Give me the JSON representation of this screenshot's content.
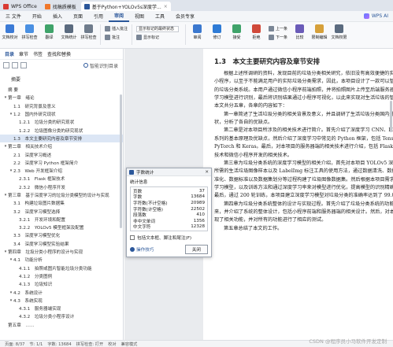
{
  "titlebar": {
    "tabs": [
      {
        "label": "WPS Office",
        "color": "#d93a33"
      },
      {
        "label": "找稿质模板",
        "color": "#f0782b"
      },
      {
        "label": "基于Python+YOLOv5s深度学...",
        "color": "#2b579a"
      }
    ]
  },
  "menu": {
    "items": [
      "三 文件",
      "开始",
      "插入",
      "页面",
      "引用",
      "审阅",
      "视图",
      "工具",
      "会员专享"
    ],
    "active": "审阅",
    "ai": "WPS AI"
  },
  "ribbon": {
    "buttons": [
      {
        "label": "文档校对",
        "color": "#3c7bd6"
      },
      {
        "label": "拼写检查",
        "color": "#4a90e2"
      },
      {
        "label": "翻译",
        "color": "#3fa36a"
      },
      {
        "label": "文档统计",
        "color": "#5b6b7f"
      },
      {
        "label": "拼写检查",
        "color": "#6f7c8c"
      }
    ],
    "insert_label": "插入批注",
    "comment_label": "批注",
    "markup": "显示标记的最终状态",
    "show_markup": "显示标记",
    "review": "审阅",
    "track": "修订",
    "accept": "接受",
    "reject": "拒绝",
    "prev": "上一条",
    "next": "下一条",
    "compare": "比较",
    "protect": "限制编辑",
    "doc_rights": "文档权限",
    "icon_colors": {
      "review": "#3b78cf",
      "track": "#2e7bd6",
      "accept": "#3fa36a",
      "reject": "#d0493a",
      "compare": "#6a5bb8",
      "protect": "#d6a03a",
      "doc_rights": "#5b6b7f"
    }
  },
  "sidebar": {
    "tabs": [
      "目录",
      "章节",
      "书签",
      "查找和替换"
    ],
    "active_tab": "目录",
    "smart": "智能识别目录",
    "heading": "摘要",
    "items": [
      {
        "level": 0,
        "arrow": "",
        "text": "摘 要"
      },
      {
        "level": 0,
        "arrow": "▾",
        "text": "第一章　绪论"
      },
      {
        "level": 1,
        "arrow": "",
        "text": "1.1　研究背景及意义"
      },
      {
        "level": 1,
        "arrow": "▾",
        "text": "1.2　国内外研究现状"
      },
      {
        "level": 2,
        "arrow": "",
        "text": "1.2.1　垃圾分类的研究现状"
      },
      {
        "level": 2,
        "arrow": "",
        "text": "1.2.2　垃圾图像分类的研究现状"
      },
      {
        "level": 1,
        "arrow": "",
        "text": "1.3　本文主要研究内容及章节安排",
        "highlight": true
      },
      {
        "level": 0,
        "arrow": "▾",
        "text": "第二章　相关技术介绍"
      },
      {
        "level": 1,
        "arrow": "",
        "text": "2.1　深度学习概述"
      },
      {
        "level": 1,
        "arrow": "",
        "text": "2.2　深度学习 Python 框架简介"
      },
      {
        "level": 1,
        "arrow": "▾",
        "text": "2.3　Web 开发框架介绍"
      },
      {
        "level": 2,
        "arrow": "",
        "text": "2.3.1　Flask 框架技术"
      },
      {
        "level": 2,
        "arrow": "",
        "text": "2.3.2　微信小程序开发"
      },
      {
        "level": 0,
        "arrow": "▾",
        "text": "第三章　基于深度学习的垃圾分类模型的设计与实现"
      },
      {
        "level": 1,
        "arrow": "",
        "text": "3.1　构建垃圾图片数据集"
      },
      {
        "level": 1,
        "arrow": "",
        "text": "3.2　深度学习模型选择"
      },
      {
        "level": 2,
        "arrow": "",
        "text": "3.2.1　开发环境和配置"
      },
      {
        "level": 2,
        "arrow": "",
        "text": "3.2.2　YOLOv5 模型框架及配置"
      },
      {
        "level": 1,
        "arrow": "",
        "text": "3.3　深度学习模型优化"
      },
      {
        "level": 1,
        "arrow": "",
        "text": "3.4　深度学习模型实验结果"
      },
      {
        "level": 0,
        "arrow": "▾",
        "text": "第四章　垃圾分类小程序的设计与实现"
      },
      {
        "level": 1,
        "arrow": "▾",
        "text": "4.1　功能分析"
      },
      {
        "level": 2,
        "arrow": "",
        "text": "4.1.1　拍照或图片智能垃圾分类功能"
      },
      {
        "level": 2,
        "arrow": "",
        "text": "4.1.2　分类图例"
      },
      {
        "level": 2,
        "arrow": "",
        "text": "4.1.3　垃圾知识"
      },
      {
        "level": 1,
        "arrow": "▾",
        "text": "4.2　系统设计"
      },
      {
        "level": 1,
        "arrow": "▾",
        "text": "4.3　系统实现"
      },
      {
        "level": 2,
        "arrow": "",
        "text": "4.3.1　服务器端实现"
      },
      {
        "level": 2,
        "arrow": "",
        "text": "4.3.2　垃圾分类小程序设计"
      },
      {
        "level": 0,
        "arrow": "",
        "text": "第五章　……"
      }
    ]
  },
  "document": {
    "heading": "1.3　本文主要研究内容及章节安排",
    "lines": [
      {
        "indent": true,
        "text": "根据上述所调研的资料，发现目前的垃圾分类相关研究，依旧没有高效便捷的实现垃圾分类"
      },
      {
        "indent": false,
        "text": "小程序，以至于不能满足用户的实际垃圾分类需求，因此，本项目设计了一款可以智能识别垃圾"
      },
      {
        "indent": false,
        "text": "的垃圾分类系统。本用户通过微信小程序前端拍照，并将拍照图片上传至后端服务器，调用深度"
      },
      {
        "indent": false,
        "text": "学习模型进行识别，最后将识别结果通过小程序可视化，以此来实现对生活垃圾的智能分类。"
      },
      {
        "indent": false,
        "text": "本文共分五章，各章的内容如下："
      },
      {
        "indent": true,
        "text": "第一章简述了生活垃圾分类的相关背景及意义，并且调研了生活垃圾分类国内外的研究现"
      },
      {
        "indent": false,
        "text": "状，分析了各自的优缺点。"
      },
      {
        "indent": true,
        "text": "第二章是对本项目所涉及的相关技术进行简介。首先介绍了深度学习 CNN、RNN、GAN"
      },
      {
        "indent": false,
        "text": "系列的基本原理及优缺点，然后介绍了深度学习中常见的 Python 框架，包括 TensorFlow、"
      },
      {
        "indent": false,
        "text": "PyTorch 和 Keras。最后，对本项目的服务器端的相关技术进行介绍，包括 Flask 框架"
      },
      {
        "indent": false,
        "text": "技术和微信小程序开发的相关技术。"
      },
      {
        "indent": true,
        "text": "第三章为垃圾分类系统的深度学习模型的相关介绍，首先对本项目 YOLOv5 深度学习模型"
      },
      {
        "indent": false,
        "text": "所需的生活垃圾图像样本以及 LabelImg 标注工具的使用方法，通过数据清洗、数据标"
      },
      {
        "indent": false,
        "text": "准化、数据标准以及数据集划分等过程构建了垃圾图像数据集。然后根据本项目需求选择深度"
      },
      {
        "indent": false,
        "text": "学习模型，以及训练方法和通过深度学习率来对模型进行优化，提高模型的识别精确率。"
      },
      {
        "indent": false,
        "text": "最后，通过 200 轮训练，本项目建立深度学习模型对垃圾分类的准确率达到了 99.0%。"
      },
      {
        "indent": true,
        "text": "第四章为垃圾分类系统整体的设计与实现过程。首先介绍了垃圾分类系统的功能需求分析，"
      },
      {
        "indent": false,
        "text": "来，并介绍了系统的整体设计，包括小程序前端和服务器端的相关设计。然后，对本系统进行"
      },
      {
        "indent": false,
        "text": "现了相关功能，并对所有的功能进行了相应的测试。"
      },
      {
        "indent": true,
        "text": "第五章总结了本文的工作。"
      }
    ]
  },
  "dialog": {
    "title": "字数统计",
    "stats_label": "统计信息",
    "rows": [
      {
        "k": "页数",
        "v": "37"
      },
      {
        "k": "字数",
        "v": "13684"
      },
      {
        "k": "字符数(不计空格)",
        "v": "20989"
      },
      {
        "k": "字符数(计空格)",
        "v": "22502"
      },
      {
        "k": "段落数",
        "v": "410"
      },
      {
        "k": "非中文单词",
        "v": "1356"
      },
      {
        "k": "中文字符",
        "v": "12328"
      }
    ],
    "checkbox": "包括文本框、脚注和尾注(F)",
    "tips": "操作技巧",
    "close": "关闭"
  },
  "status": {
    "items": [
      "页面: 8/37",
      "节: 1/1",
      "字数: 13684",
      "拼写检查: 打开",
      "校对",
      "兼容模式"
    ]
  },
  "watermark": "CSDN @程序员小马软件开发定制"
}
